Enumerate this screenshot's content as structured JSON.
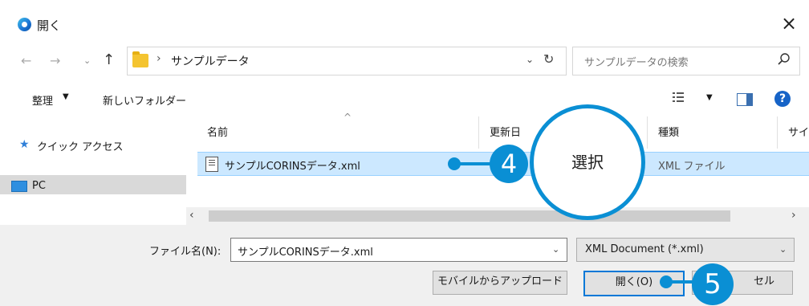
{
  "window": {
    "title": "開く",
    "close_label": "×"
  },
  "address_bar": {
    "back": "←",
    "forward": "→",
    "recent": "⌄",
    "up": "↑",
    "crumb_separator": "›",
    "path": "サンプルデータ",
    "dropdown": "⌄",
    "refresh": "↻",
    "search_placeholder": "サンプルデータの検索"
  },
  "toolbar": {
    "organize_label": "整理",
    "organize_caret": "▼",
    "new_folder_label": "新しいフォルダー",
    "view_caret": "▼",
    "help_label": "?"
  },
  "nav_pane": {
    "quick_access_label": "クイック アクセス",
    "pc_label": "PC"
  },
  "file_list": {
    "columns": {
      "name": "名前",
      "date": "更新日",
      "type": "種類",
      "size": "サイ"
    },
    "sort_indicator": "^",
    "files": [
      {
        "name": "サンプルCORINSデータ.xml",
        "type": "XML ファイル",
        "selected": true
      }
    ]
  },
  "hscroll": {
    "left": "‹",
    "right": "›"
  },
  "bottom": {
    "filename_label": "ファイル名(N):",
    "filename_value": "サンプルCORINSデータ.xml",
    "filename_dropdown": "⌄",
    "filter_value": "XML Document (*.xml)",
    "filter_dropdown": "⌄",
    "mobile_upload_button": "モバイルからアップロード",
    "open_button": "開く(O)",
    "cancel_button": "セル"
  },
  "annotations": {
    "step4_number": "4",
    "step4_text": "選択",
    "step5_number": "5"
  },
  "colors": {
    "accent": "#0a8fd4",
    "selection": "#cce8ff",
    "primary_border": "#0078d7"
  }
}
